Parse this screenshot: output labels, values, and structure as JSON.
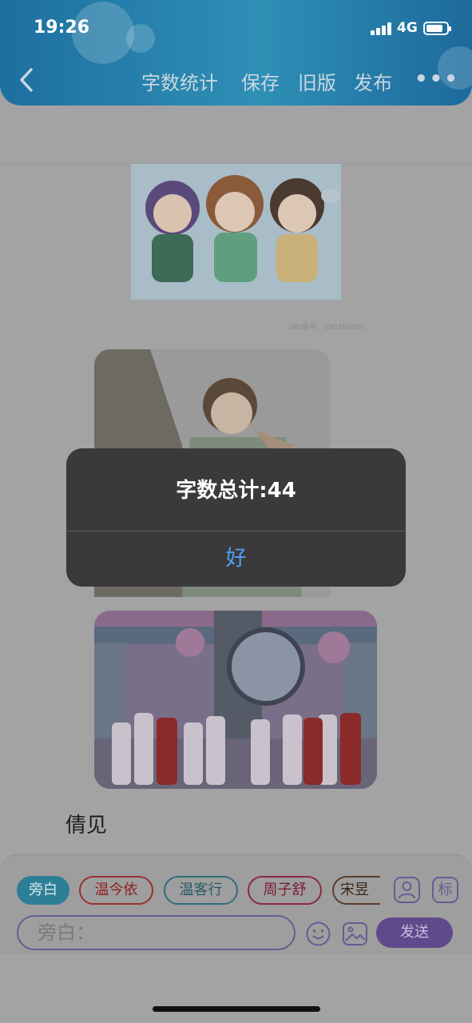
{
  "status_bar": {
    "time": "19:26",
    "network": "4G",
    "battery_level": 0.85
  },
  "nav": {
    "back_icon": "chevron-left-icon",
    "items": [
      "字数统计",
      "保存",
      "旧版",
      "发布"
    ],
    "more_label": "•••"
  },
  "content": {
    "watermark": "UID账号：490360400",
    "text_line": "倩见"
  },
  "input_panel": {
    "chips": [
      "旁白",
      "温今依",
      "温客行",
      "周子舒",
      "宋昱"
    ],
    "icon_button_1": "person-icon",
    "icon_button_2_label": "标",
    "input_placeholder": "旁白：",
    "emoji_icon": "smiley-icon",
    "image_icon": "image-icon",
    "send_label": "发送"
  },
  "alert": {
    "message": "字数总计:44",
    "ok_label": "好"
  },
  "colors": {
    "accent": "#4ea2f8",
    "header": "#2e8fb5",
    "send": "#5f4a8c"
  }
}
